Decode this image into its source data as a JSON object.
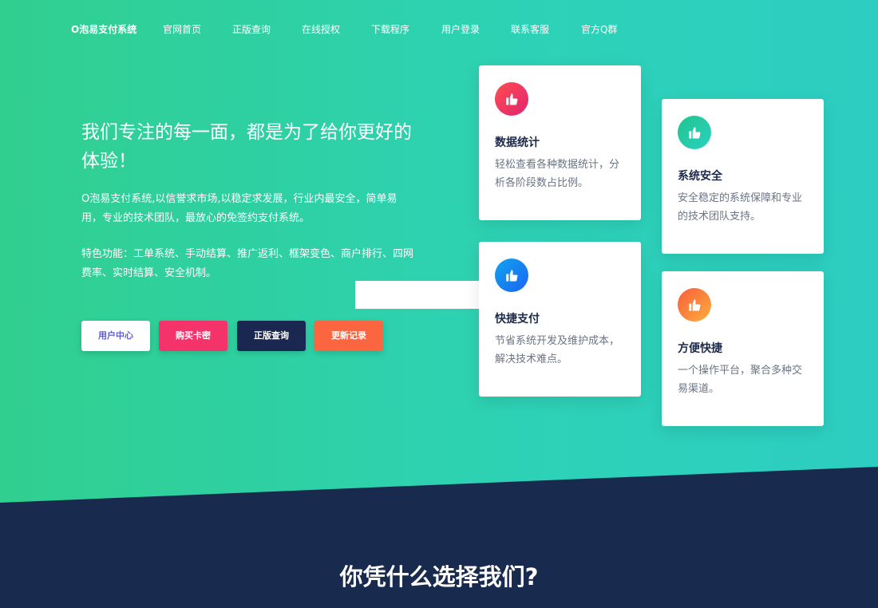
{
  "nav": {
    "brand": "O泡易支付系统",
    "items": [
      "官网首页",
      "正版查询",
      "在线授权",
      "下载程序",
      "用户登录",
      "联系客服",
      "官方Q群"
    ]
  },
  "hero": {
    "headline": "我们专注的每一面，都是为了给你更好的体验！",
    "desc1": "O泡易支付系统,以信誉求市场,以稳定求发展，行业内最安全，简单易用，专业的技术团队，最放心的免签约支付系统。",
    "desc2": "特色功能：工单系统、手动结算、推广返利、框架变色、商户排行、四网费率、实时结算、安全机制。",
    "buttons": {
      "user_center": "用户中心",
      "buy_card": "购买卡密",
      "genuine_query": "正版查询",
      "changelog": "更新记录"
    },
    "button_colors": {
      "buy_card": "#f5336b",
      "genuine_query": "#1a2750",
      "changelog": "#fb6640"
    }
  },
  "features": [
    {
      "title": "数据统计",
      "desc": "轻松查看各种数据统计，分析各阶段数占比例。",
      "icon": "thumbs-up-icon"
    },
    {
      "title": "系统安全",
      "desc": "安全稳定的系统保障和专业的技术团队支持。",
      "icon": "thumbs-up-icon"
    },
    {
      "title": "快捷支付",
      "desc": "节省系统开发及维护成本，解决技术难点。",
      "icon": "thumbs-up-icon"
    },
    {
      "title": "方便快捷",
      "desc": "一个操作平台，聚合多种交易渠道。",
      "icon": "thumbs-up-icon"
    }
  ],
  "section": {
    "title": "你凭什么选择我们?"
  },
  "colors": {
    "hero_start": "#30cf8f",
    "hero_end": "#2dcdc2",
    "dark_navy": "#182a4d"
  }
}
